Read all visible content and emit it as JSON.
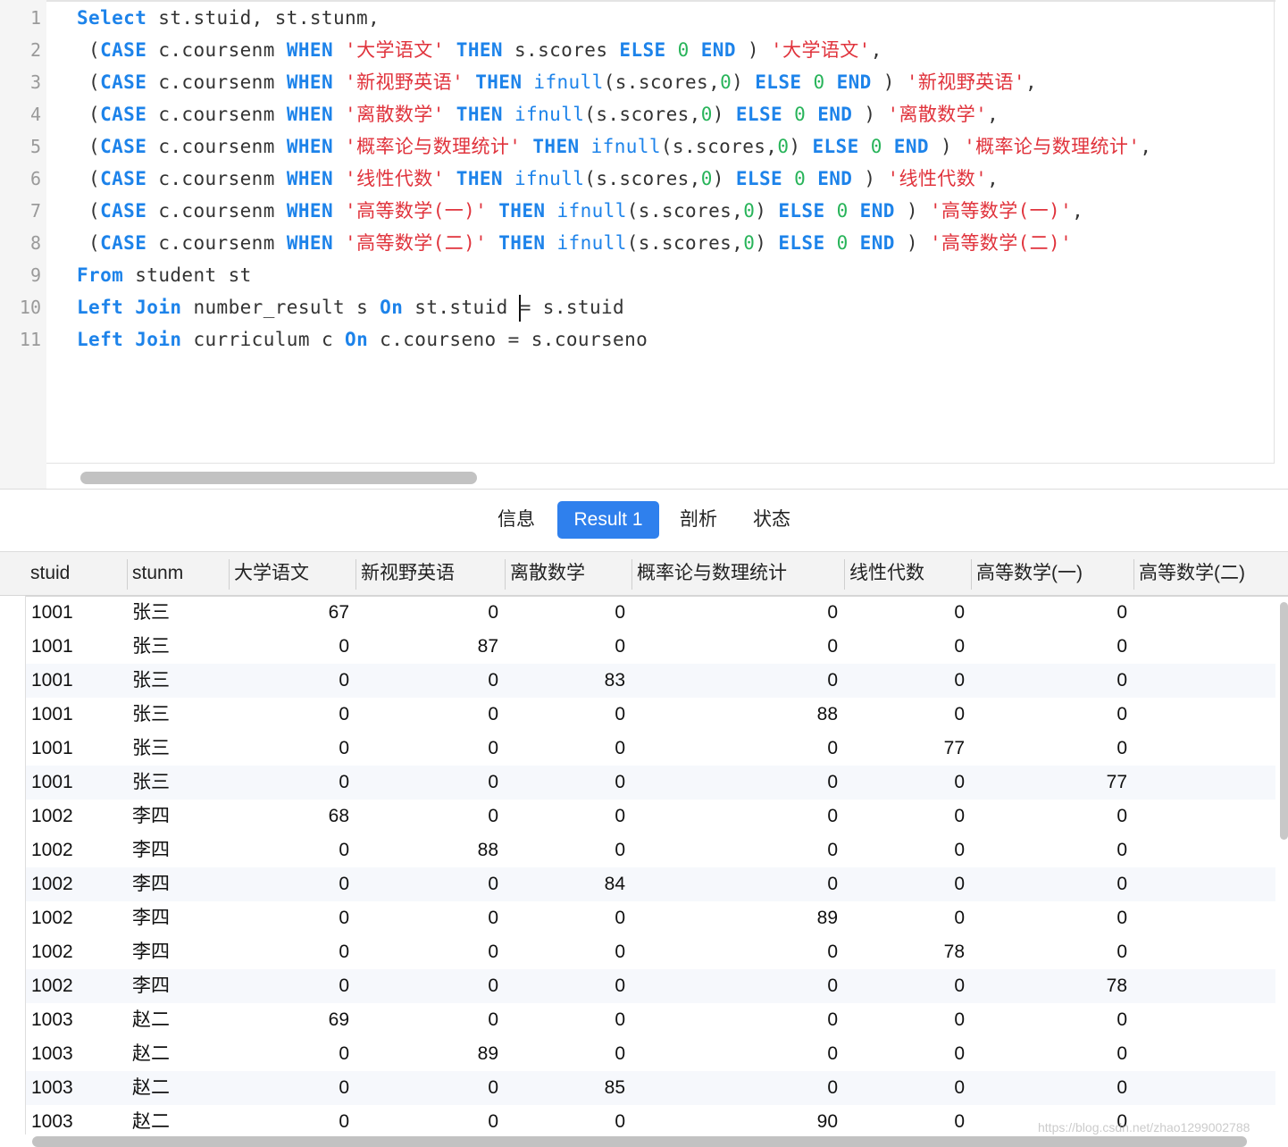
{
  "editor": {
    "line_numbers": [
      "1",
      "2",
      "3",
      "4",
      "5",
      "6",
      "7",
      "8",
      "9",
      "10",
      "11"
    ],
    "lines": [
      [
        [
          "kw",
          "Select"
        ],
        [
          "p",
          " st.stuid, st.stunm,"
        ]
      ],
      [
        [
          "p",
          " ("
        ],
        [
          "kw",
          "CASE"
        ],
        [
          "p",
          " c.coursenm "
        ],
        [
          "kw",
          "WHEN"
        ],
        [
          "p",
          " "
        ],
        [
          "str",
          "'大学语文'"
        ],
        [
          "p",
          " "
        ],
        [
          "kw",
          "THEN"
        ],
        [
          "p",
          " s.scores "
        ],
        [
          "kw",
          "ELSE"
        ],
        [
          "p",
          " "
        ],
        [
          "num",
          "0"
        ],
        [
          "p",
          " "
        ],
        [
          "kw",
          "END"
        ],
        [
          "p",
          " ) "
        ],
        [
          "str",
          "'大学语文'"
        ],
        [
          "p",
          ","
        ]
      ],
      [
        [
          "p",
          " ("
        ],
        [
          "kw",
          "CASE"
        ],
        [
          "p",
          " c.coursenm "
        ],
        [
          "kw",
          "WHEN"
        ],
        [
          "p",
          " "
        ],
        [
          "str",
          "'新视野英语'"
        ],
        [
          "p",
          " "
        ],
        [
          "kw",
          "THEN"
        ],
        [
          "p",
          " "
        ],
        [
          "fn",
          "ifnull"
        ],
        [
          "p",
          "(s.scores,"
        ],
        [
          "num",
          "0"
        ],
        [
          "p",
          ") "
        ],
        [
          "kw",
          "ELSE"
        ],
        [
          "p",
          " "
        ],
        [
          "num",
          "0"
        ],
        [
          "p",
          " "
        ],
        [
          "kw",
          "END"
        ],
        [
          "p",
          " ) "
        ],
        [
          "str",
          "'新视野英语'"
        ],
        [
          "p",
          ","
        ]
      ],
      [
        [
          "p",
          " ("
        ],
        [
          "kw",
          "CASE"
        ],
        [
          "p",
          " c.coursenm "
        ],
        [
          "kw",
          "WHEN"
        ],
        [
          "p",
          " "
        ],
        [
          "str",
          "'离散数学'"
        ],
        [
          "p",
          " "
        ],
        [
          "kw",
          "THEN"
        ],
        [
          "p",
          " "
        ],
        [
          "fn",
          "ifnull"
        ],
        [
          "p",
          "(s.scores,"
        ],
        [
          "num",
          "0"
        ],
        [
          "p",
          ") "
        ],
        [
          "kw",
          "ELSE"
        ],
        [
          "p",
          " "
        ],
        [
          "num",
          "0"
        ],
        [
          "p",
          " "
        ],
        [
          "kw",
          "END"
        ],
        [
          "p",
          " ) "
        ],
        [
          "str",
          "'离散数学'"
        ],
        [
          "p",
          ","
        ]
      ],
      [
        [
          "p",
          " ("
        ],
        [
          "kw",
          "CASE"
        ],
        [
          "p",
          " c.coursenm "
        ],
        [
          "kw",
          "WHEN"
        ],
        [
          "p",
          " "
        ],
        [
          "str",
          "'概率论与数理统计'"
        ],
        [
          "p",
          " "
        ],
        [
          "kw",
          "THEN"
        ],
        [
          "p",
          " "
        ],
        [
          "fn",
          "ifnull"
        ],
        [
          "p",
          "(s.scores,"
        ],
        [
          "num",
          "0"
        ],
        [
          "p",
          ") "
        ],
        [
          "kw",
          "ELSE"
        ],
        [
          "p",
          " "
        ],
        [
          "num",
          "0"
        ],
        [
          "p",
          " "
        ],
        [
          "kw",
          "END"
        ],
        [
          "p",
          " ) "
        ],
        [
          "str",
          "'概率论与数理统计'"
        ],
        [
          "p",
          ","
        ]
      ],
      [
        [
          "p",
          " ("
        ],
        [
          "kw",
          "CASE"
        ],
        [
          "p",
          " c.coursenm "
        ],
        [
          "kw",
          "WHEN"
        ],
        [
          "p",
          " "
        ],
        [
          "str",
          "'线性代数'"
        ],
        [
          "p",
          " "
        ],
        [
          "kw",
          "THEN"
        ],
        [
          "p",
          " "
        ],
        [
          "fn",
          "ifnull"
        ],
        [
          "p",
          "(s.scores,"
        ],
        [
          "num",
          "0"
        ],
        [
          "p",
          ") "
        ],
        [
          "kw",
          "ELSE"
        ],
        [
          "p",
          " "
        ],
        [
          "num",
          "0"
        ],
        [
          "p",
          " "
        ],
        [
          "kw",
          "END"
        ],
        [
          "p",
          " ) "
        ],
        [
          "str",
          "'线性代数'"
        ],
        [
          "p",
          ","
        ]
      ],
      [
        [
          "p",
          " ("
        ],
        [
          "kw",
          "CASE"
        ],
        [
          "p",
          " c.coursenm "
        ],
        [
          "kw",
          "WHEN"
        ],
        [
          "p",
          " "
        ],
        [
          "str",
          "'高等数学(一)'"
        ],
        [
          "p",
          " "
        ],
        [
          "kw",
          "THEN"
        ],
        [
          "p",
          " "
        ],
        [
          "fn",
          "ifnull"
        ],
        [
          "p",
          "(s.scores,"
        ],
        [
          "num",
          "0"
        ],
        [
          "p",
          ") "
        ],
        [
          "kw",
          "ELSE"
        ],
        [
          "p",
          " "
        ],
        [
          "num",
          "0"
        ],
        [
          "p",
          " "
        ],
        [
          "kw",
          "END"
        ],
        [
          "p",
          " ) "
        ],
        [
          "str",
          "'高等数学(一)'"
        ],
        [
          "p",
          ","
        ]
      ],
      [
        [
          "p",
          " ("
        ],
        [
          "kw",
          "CASE"
        ],
        [
          "p",
          " c.coursenm "
        ],
        [
          "kw",
          "WHEN"
        ],
        [
          "p",
          " "
        ],
        [
          "str",
          "'高等数学(二)'"
        ],
        [
          "p",
          " "
        ],
        [
          "kw",
          "THEN"
        ],
        [
          "p",
          " "
        ],
        [
          "fn",
          "ifnull"
        ],
        [
          "p",
          "(s.scores,"
        ],
        [
          "num",
          "0"
        ],
        [
          "p",
          ") "
        ],
        [
          "kw",
          "ELSE"
        ],
        [
          "p",
          " "
        ],
        [
          "num",
          "0"
        ],
        [
          "p",
          " "
        ],
        [
          "kw",
          "END"
        ],
        [
          "p",
          " ) "
        ],
        [
          "str",
          "'高等数学(二)'"
        ]
      ],
      [
        [
          "kw",
          "From"
        ],
        [
          "p",
          " student st"
        ]
      ],
      [
        [
          "kw",
          "Left"
        ],
        [
          "p",
          " "
        ],
        [
          "kw",
          "Join"
        ],
        [
          "p",
          " number_result s "
        ],
        [
          "kw",
          "On"
        ],
        [
          "p",
          " st.stuid "
        ],
        [
          "cursor",
          ""
        ],
        [
          "p",
          "= s.stuid"
        ]
      ],
      [
        [
          "kw",
          "Left"
        ],
        [
          "p",
          " "
        ],
        [
          "kw",
          "Join"
        ],
        [
          "p",
          " curriculum c "
        ],
        [
          "kw",
          "On"
        ],
        [
          "p",
          " c.courseno = s.courseno"
        ]
      ]
    ]
  },
  "tabs": [
    {
      "label": "信息",
      "active": false
    },
    {
      "label": "Result 1",
      "active": true
    },
    {
      "label": "剖析",
      "active": false
    },
    {
      "label": "状态",
      "active": false
    }
  ],
  "grid": {
    "columns": [
      "stuid",
      "stunm",
      "大学语文",
      "新视野英语",
      "离散数学",
      "概率论与数理统计",
      "线性代数",
      "高等数学(一)",
      "高等数学(二)"
    ],
    "rows": [
      [
        "1001",
        "张三",
        "67",
        "0",
        "0",
        "0",
        "0",
        "0"
      ],
      [
        "1001",
        "张三",
        "0",
        "87",
        "0",
        "0",
        "0",
        "0"
      ],
      [
        "1001",
        "张三",
        "0",
        "0",
        "83",
        "0",
        "0",
        "0"
      ],
      [
        "1001",
        "张三",
        "0",
        "0",
        "0",
        "88",
        "0",
        "0"
      ],
      [
        "1001",
        "张三",
        "0",
        "0",
        "0",
        "0",
        "77",
        "0"
      ],
      [
        "1001",
        "张三",
        "0",
        "0",
        "0",
        "0",
        "0",
        "77"
      ],
      [
        "1002",
        "李四",
        "68",
        "0",
        "0",
        "0",
        "0",
        "0"
      ],
      [
        "1002",
        "李四",
        "0",
        "88",
        "0",
        "0",
        "0",
        "0"
      ],
      [
        "1002",
        "李四",
        "0",
        "0",
        "84",
        "0",
        "0",
        "0"
      ],
      [
        "1002",
        "李四",
        "0",
        "0",
        "0",
        "89",
        "0",
        "0"
      ],
      [
        "1002",
        "李四",
        "0",
        "0",
        "0",
        "0",
        "78",
        "0"
      ],
      [
        "1002",
        "李四",
        "0",
        "0",
        "0",
        "0",
        "0",
        "78"
      ],
      [
        "1003",
        "赵二",
        "69",
        "0",
        "0",
        "0",
        "0",
        "0"
      ],
      [
        "1003",
        "赵二",
        "0",
        "89",
        "0",
        "0",
        "0",
        "0"
      ],
      [
        "1003",
        "赵二",
        "0",
        "0",
        "85",
        "0",
        "0",
        "0"
      ],
      [
        "1003",
        "赵二",
        "0",
        "0",
        "0",
        "90",
        "0",
        "0"
      ]
    ]
  },
  "watermark": "https://blog.csdn.net/zhao1299002788",
  "colors": {
    "keyword": "#1d83ea",
    "string": "#e0333c",
    "number": "#28b45a",
    "active_tab": "#2f80ed"
  }
}
